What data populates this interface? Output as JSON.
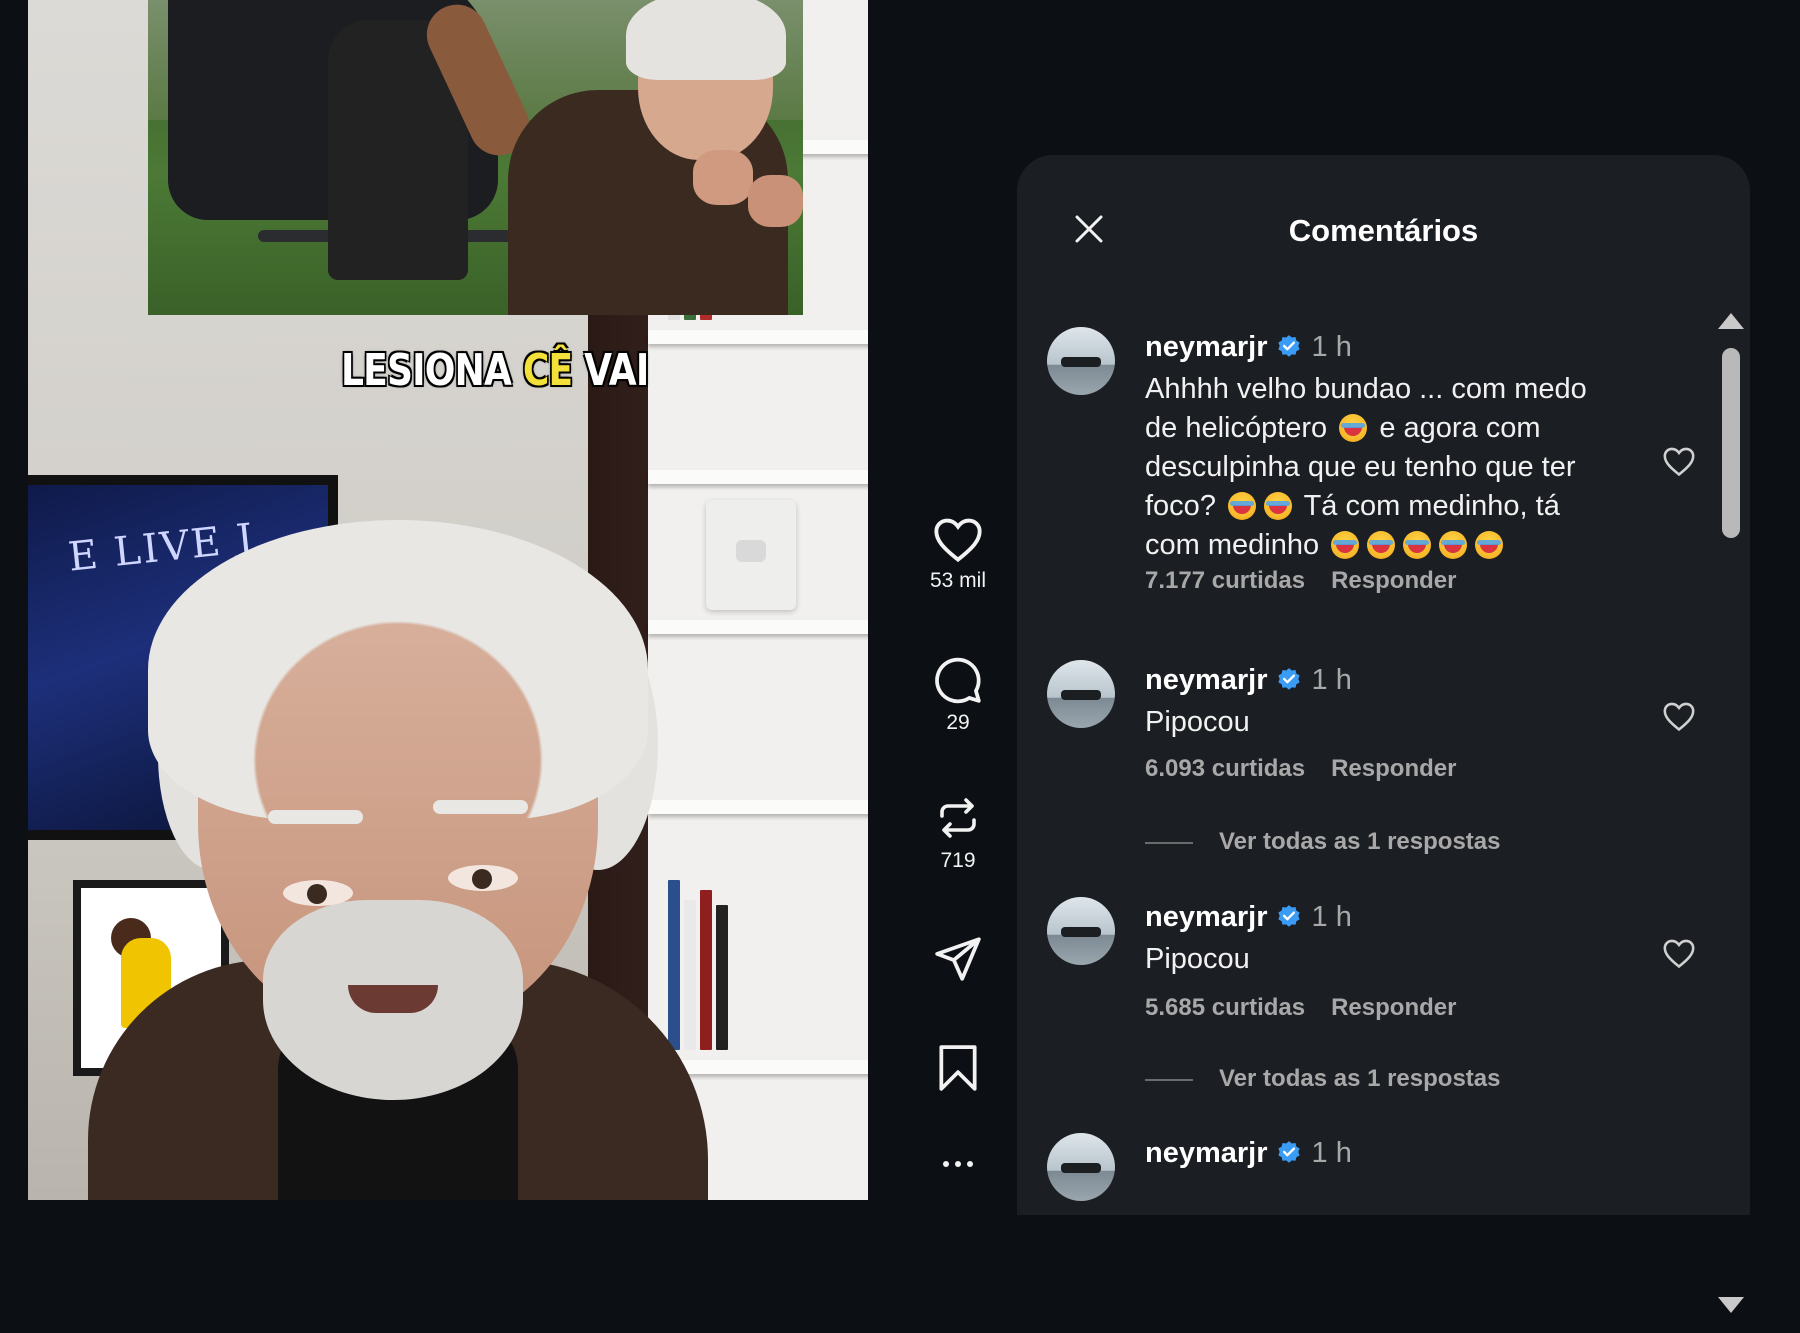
{
  "video": {
    "caption_part1": "LESIONA",
    "caption_part2": "CÊ",
    "caption_part3": "VAI",
    "caption_highlight_color": "#f4e03a",
    "poster_text": "E LIVE J"
  },
  "actions": {
    "like_count": "53 mil",
    "comment_count": "29",
    "repost_count": "719",
    "more_label": "..."
  },
  "panel": {
    "title": "Comentários",
    "comments": [
      {
        "username": "neymarjr",
        "time": "1 h",
        "lines": [
          "Ahhhh velho bundao ... com medo",
          "de helicóptero",
          "e agora com",
          "desculpinha que eu tenho que ter",
          "foco?",
          "Tá com medinho, tá",
          "com medinho"
        ],
        "likes": "7.177 curtidas",
        "reply_label": "Responder"
      },
      {
        "username": "neymarjr",
        "time": "1 h",
        "text": "Pipocou",
        "likes": "6.093 curtidas",
        "reply_label": "Responder",
        "view_replies": "Ver todas as 1 respostas"
      },
      {
        "username": "neymarjr",
        "time": "1 h",
        "text": "Pipocou",
        "likes": "5.685 curtidas",
        "reply_label": "Responder",
        "view_replies": "Ver todas as 1 respostas"
      },
      {
        "username": "neymarjr",
        "time": "1 h"
      }
    ]
  },
  "colors": {
    "background": "#0c0f14",
    "panel": "#1b1e23",
    "verified": "#3b9cf5",
    "muted_text": "#a8a8a8"
  },
  "icons": [
    "close-icon",
    "heart-icon",
    "comment-icon",
    "repost-icon",
    "share-icon",
    "bookmark-icon",
    "more-icon",
    "verified-icon",
    "laughing-emoji-icon"
  ]
}
